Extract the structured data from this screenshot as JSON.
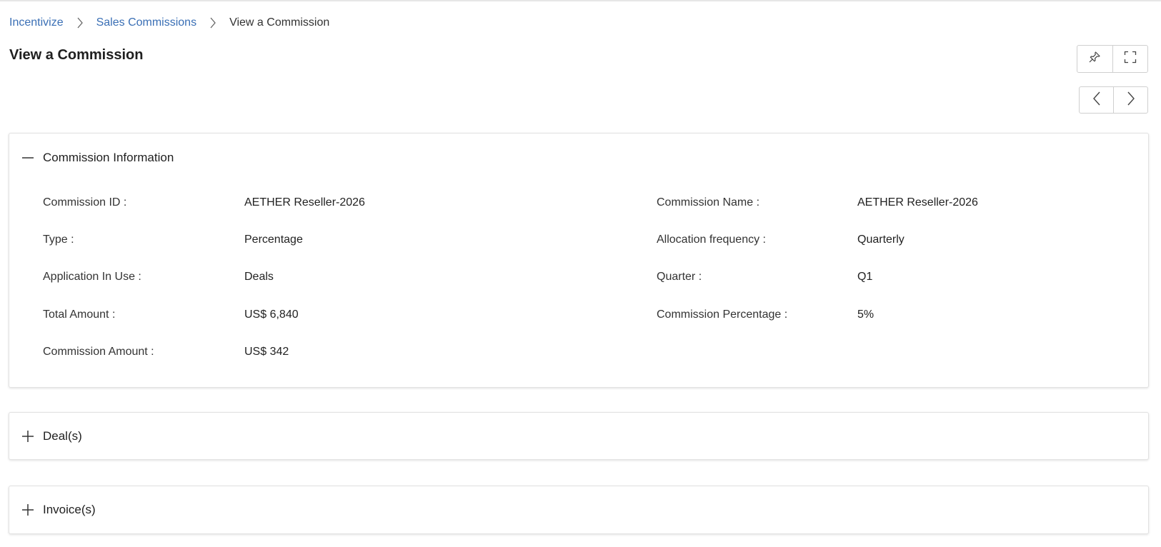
{
  "breadcrumb": {
    "items": [
      "Incentivize",
      "Sales Commissions"
    ],
    "current": "View a Commission"
  },
  "page": {
    "title": "View a Commission"
  },
  "toolbar": {
    "pin_icon": "pin-icon",
    "fullscreen_icon": "fullscreen-icon",
    "prev_icon": "chevron-left-icon",
    "next_icon": "chevron-right-icon"
  },
  "sections": {
    "commission_info": {
      "title": "Commission Information",
      "expanded": true,
      "fields": {
        "commission_id": {
          "label": "Commission ID :",
          "value": "AETHER Reseller-2026"
        },
        "commission_name": {
          "label": "Commission Name :",
          "value": "AETHER Reseller-2026"
        },
        "type": {
          "label": "Type :",
          "value": "Percentage"
        },
        "allocation_frequency": {
          "label": "Allocation frequency :",
          "value": "Quarterly"
        },
        "application_in_use": {
          "label": "Application In Use :",
          "value": "Deals"
        },
        "quarter": {
          "label": "Quarter :",
          "value": "Q1"
        },
        "total_amount": {
          "label": "Total Amount :",
          "value": "US$ 6,840"
        },
        "commission_percentage": {
          "label": "Commission Percentage :",
          "value": "5%"
        },
        "commission_amount": {
          "label": "Commission Amount :",
          "value": "US$ 342"
        }
      }
    },
    "deals": {
      "title": "Deal(s)",
      "expanded": false
    },
    "invoices": {
      "title": "Invoice(s)",
      "expanded": false
    }
  },
  "colors": {
    "link": "#3a6fb5",
    "text": "#222222",
    "border": "#e2e2e2"
  }
}
